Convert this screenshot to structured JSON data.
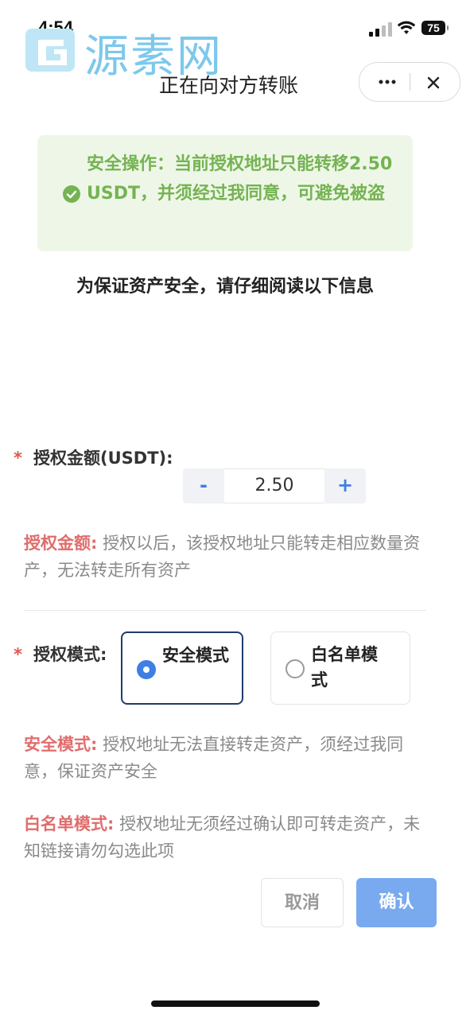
{
  "status_bar": {
    "time": "4:54",
    "battery": "75"
  },
  "watermark": {
    "text": "源素网"
  },
  "header": {
    "title": "正在向对方转账"
  },
  "notice": {
    "text": "安全操作：当前授权地址只能转移2.50 USDT，并须经过我同意，可避免被盗"
  },
  "subtitle": "为保证资产安全，请仔细阅读以下信息",
  "amount": {
    "required_mark": "*",
    "label": "授权金额(USDT):",
    "minus": "-",
    "plus": "+",
    "value": "2.50",
    "desc_key": "授权金额:",
    "desc_text": " 授权以后，该授权地址只能转走相应数量资产，无法转走所有资产"
  },
  "mode": {
    "required_mark": "*",
    "label": "授权模式:",
    "options": [
      {
        "label": "安全模式",
        "selected": true
      },
      {
        "label": "白名单模式",
        "selected": false
      }
    ],
    "safe_desc_key": "安全模式:",
    "safe_desc_text": " 授权地址无法直接转走资产，须经过我同意，保证资产安全",
    "white_desc_key": "白名单模式:",
    "white_desc_text": " 授权地址无须经过确认即可转走资产，未知链接请勿勾选此项"
  },
  "buttons": {
    "cancel": "取消",
    "confirm": "确认"
  },
  "colors": {
    "accent": "#3d7fe3",
    "confirm": "#79aaf0",
    "notice_bg": "#eef7e7",
    "notice_text": "#75b353",
    "highlight": "#e06d6d"
  },
  "icons": [
    "signal-icon",
    "wifi-icon",
    "battery-icon",
    "more-icon",
    "close-icon",
    "check-circle-icon"
  ]
}
